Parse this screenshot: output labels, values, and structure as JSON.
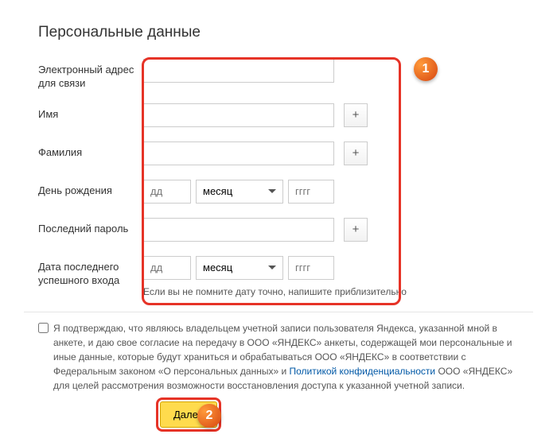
{
  "title": "Персональные данные",
  "labels": {
    "email": "Электронный адрес для связи",
    "firstname": "Имя",
    "lastname": "Фамилия",
    "birthday": "День рождения",
    "lastpassword": "Последний пароль",
    "lastlogin": "Дата последнего успешного входа"
  },
  "placeholders": {
    "day": "дд",
    "month": "месяц",
    "year": "гггг"
  },
  "plus": "+",
  "hint": "Если вы не помните дату точно, напишите приблизительно",
  "consent": {
    "pre": "Я подтверждаю, что являюсь владельцем учетной записи пользователя Яндекса, указанной мной в анкете, и даю свое согласие на передачу в ООО «ЯНДЕКС» анкеты, содержащей мои персональные и иные данные, которые будут храниться и обрабатываться ООО «ЯНДЕКС» в соответствии с Федеральным законом «О персональных данных» и ",
    "link": "Политикой конфиденциальности",
    "post": " ООО «ЯНДЕКС» для целей рассмотрения возможности восстановления доступа к указанной учетной записи."
  },
  "next": "Далее",
  "markers": {
    "one": "1",
    "two": "2"
  }
}
